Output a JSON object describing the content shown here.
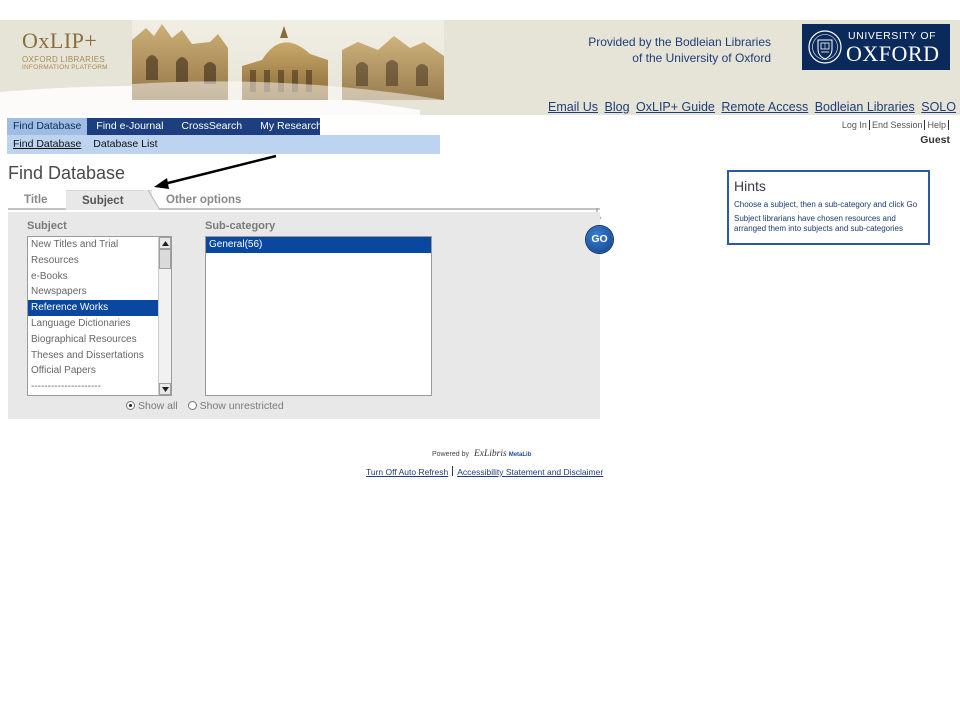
{
  "header": {
    "logo_title": "OxLIP+",
    "logo_sub1": "OXFORD LIBRARIES",
    "logo_sub2": "INFORMATION PLATFORM",
    "provided_line1": "Provided by the Bodleian Libraries",
    "provided_line2": "of the University of Oxford",
    "oxford_univ": "UNIVERSITY OF",
    "oxford_name": "OXFORD",
    "brand_color": "#0b2a5c"
  },
  "top_links": [
    "Email Us",
    "Blog",
    "OxLIP+ Guide",
    "Remote Access",
    "Bodleian Libraries",
    "SOLO"
  ],
  "nav": {
    "tabs": [
      "Find Database",
      "Find e-Journal",
      "CrossSearch",
      "My Research"
    ],
    "active_tab": "Find Database",
    "sub_items": [
      "Find Database",
      "Database List"
    ]
  },
  "user": {
    "links": [
      "Log In",
      "End Session",
      "Help"
    ],
    "name": "Guest"
  },
  "page": {
    "title": "Find Database",
    "tabs": [
      "Title",
      "Subject",
      "Other options"
    ],
    "active_tab": "Subject"
  },
  "form": {
    "subject_label": "Subject",
    "subcategory_label": "Sub-category",
    "subjects": [
      "New Titles and Trial",
      "Resources",
      "e-Books",
      "Newspapers",
      "Reference Works",
      "Language Dictionaries",
      "Biographical Resources",
      "Theses and Dissertations",
      "Official Papers",
      "---------------------"
    ],
    "selected_subject": "Reference Works",
    "subcategories": [
      "General(56)"
    ],
    "selected_subcategory": "General(56)",
    "show_all": "Show all",
    "show_unrestricted": "Show unrestricted",
    "go_label": "GO"
  },
  "hints": {
    "title": "Hints",
    "lines": [
      "Choose a subject, then a sub-category and click Go",
      "Subject librarians have chosen resources and arranged them into subjects and sub-categories"
    ]
  },
  "footer": {
    "powered_by": "Powered by",
    "exlibris": "ExLibris",
    "metalib": "MetaLib",
    "links": [
      "Turn Off Auto Refresh",
      "Accessibility Statement and Disclaimer"
    ]
  }
}
